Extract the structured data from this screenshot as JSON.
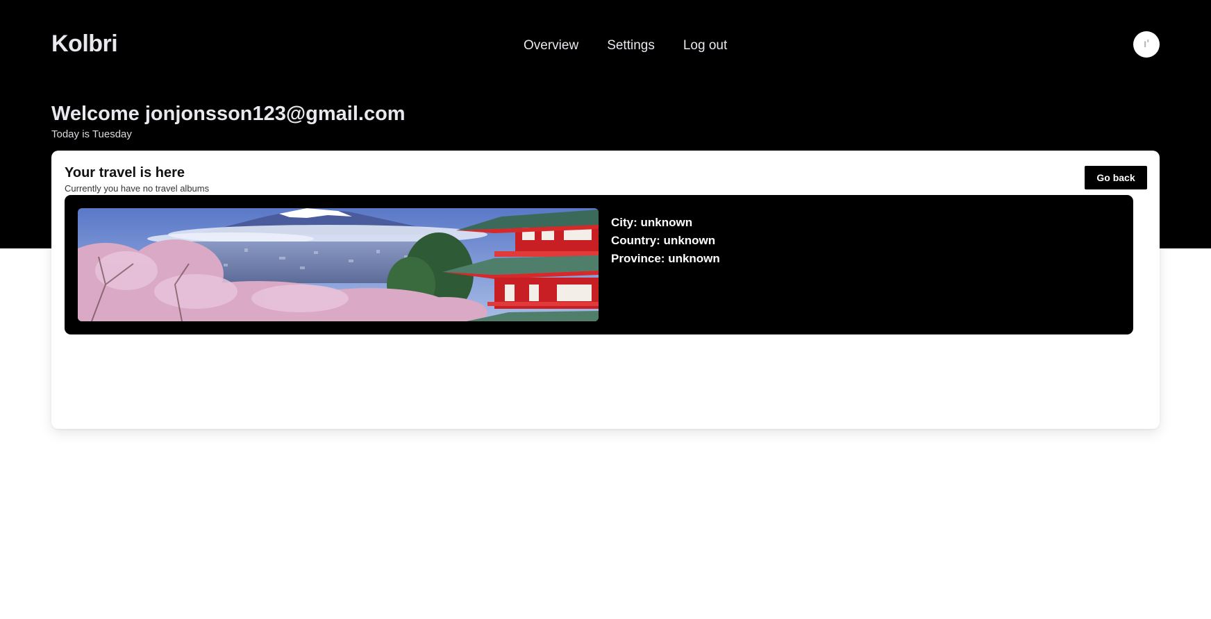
{
  "app": {
    "name": "Kolbri"
  },
  "nav": {
    "items": [
      {
        "label": "Overview"
      },
      {
        "label": "Settings"
      },
      {
        "label": "Log out"
      }
    ]
  },
  "header": {
    "welcome": "Welcome jonjonsson123@gmail.com",
    "today": "Today is Tuesday"
  },
  "travel": {
    "title": "Your travel is here",
    "subtitle": "Currently you have no travel albums",
    "go_back_label": "Go back",
    "album": {
      "image_icon": "mountain-pagoda-cherry-blossom-photo",
      "city": "City: unknown",
      "country": "Country: unknown",
      "province": "Province: unknown"
    }
  },
  "colors": {
    "background_dark": "#000000",
    "text_light": "#e8e8ee",
    "card": "#ffffff",
    "pagoda_red": "#d62a2a",
    "blossom_pink": "#d9a9c6"
  }
}
